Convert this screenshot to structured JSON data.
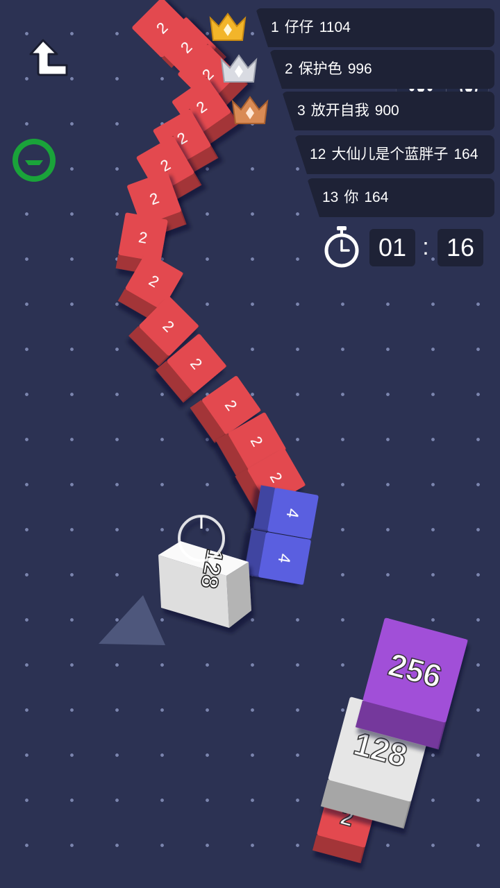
{
  "leaderboard": [
    {
      "rank": "1",
      "name": "仔仔",
      "score": "1104"
    },
    {
      "rank": "2",
      "name": "保护色",
      "score": "996"
    },
    {
      "rank": "3",
      "name": "放开自我",
      "score": "900"
    },
    {
      "rank": "12",
      "name": "大仙儿是个蓝胖子",
      "score": "164"
    },
    {
      "rank": "13",
      "name": "你",
      "score": "164"
    }
  ],
  "timer": {
    "minutes": "01",
    "colon": ":",
    "seconds": "16"
  },
  "player_snake": {
    "head": "128",
    "body": [
      "4",
      "4",
      "2",
      "2",
      "2",
      "2",
      "2",
      "2",
      "2",
      "2",
      "2",
      "2",
      "2",
      "2",
      "2",
      "2",
      "2",
      "2"
    ]
  },
  "enemy_snake": {
    "blocks": [
      "256",
      "128",
      "2"
    ]
  },
  "icons": {
    "back": "back-arrow-icon",
    "chat": "emoji-chat-icon",
    "more": "more-dots-icon",
    "close": "target-close-icon",
    "gold": "gold-crown-icon",
    "silver": "silver-crown-icon",
    "bronze": "bronze-crown-icon",
    "timer": "stopwatch-icon",
    "direction": "direction-arrow-icon"
  },
  "colors": {
    "background": "#2c3253",
    "red_block": "#e3494f",
    "blue_block": "#5a5fe0",
    "white_block": "#e6e6e6",
    "purple_block": "#a14fd8",
    "panel": "#1e2236"
  }
}
